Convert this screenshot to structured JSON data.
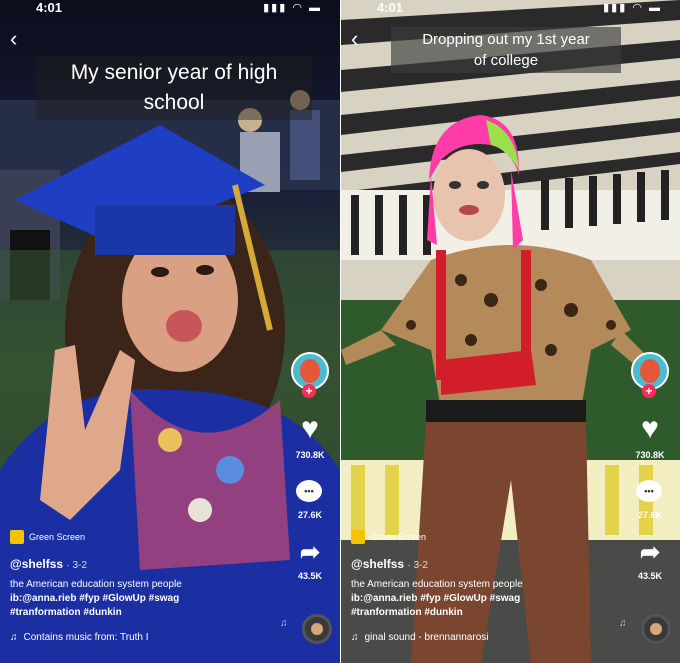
{
  "left": {
    "status": {
      "time": "4:01",
      "icons": "▮▮▮ ◠ ▬"
    },
    "caption": "My senior year of high school",
    "actions": {
      "likes": "730.8K",
      "comments": "27.6K",
      "shares": "43.5K"
    },
    "effect": "Green Screen",
    "username": "@shelfss",
    "date": "· 3-2",
    "desc_line1": "the American education system people",
    "desc_line2": "ib:@anna.rieb #fyp #GlowUp #swag",
    "desc_line3": "#tranformation #dunkin",
    "music": "Contains music from: Truth I"
  },
  "right": {
    "status": {
      "time": "4:01",
      "icons": "▮▮▮ ◠ ▬"
    },
    "caption_line1": "Dropping out my 1st year",
    "caption_line2": "of college",
    "actions": {
      "likes": "730.8K",
      "comments": "27.6K",
      "shares": "43.5K"
    },
    "effect": "Green Screen",
    "username": "@shelfss",
    "date": "· 3-2",
    "desc_line1": "the American education system people",
    "desc_line2": "ib:@anna.rieb #fyp #GlowUp #swag",
    "desc_line3": "#tranformation #dunkin",
    "music": "ginal sound - brennannarosi"
  },
  "icons": {
    "back": "‹",
    "heart": "♥",
    "comment": "•••",
    "share": "➦",
    "music_note": "♫"
  },
  "colors": {
    "tiktok_red": "#fe2c55",
    "cap_blue": "#1e3fc4",
    "hair_pink": "#ff3da8",
    "effect_yellow": "#f5c400"
  }
}
